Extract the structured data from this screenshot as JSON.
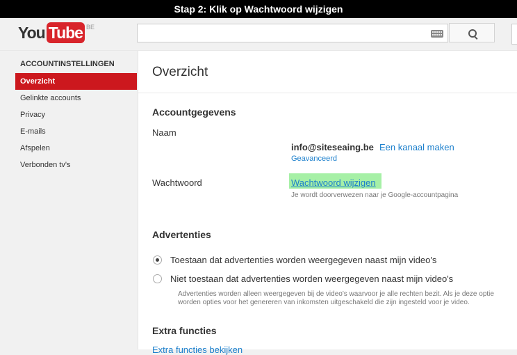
{
  "caption": "Stap 2: Klik op Wachtwoord wijzigen",
  "header": {
    "logo_you": "You",
    "logo_tube": "Tube",
    "logo_country": "BE"
  },
  "sidebar": {
    "title": "ACCOUNTINSTELLINGEN",
    "items": [
      {
        "label": "Overzicht"
      },
      {
        "label": "Gelinkte accounts"
      },
      {
        "label": "Privacy"
      },
      {
        "label": "E-mails"
      },
      {
        "label": "Afspelen"
      },
      {
        "label": "Verbonden tv's"
      }
    ]
  },
  "main": {
    "title": "Overzicht",
    "account_section": "Accountgegevens",
    "name_label": "Naam",
    "email": "info@siteseaing.be",
    "create_channel": "Een kanaal maken",
    "advanced": "Geavanceerd",
    "password_label": "Wachtwoord",
    "change_password": "Wachtwoord wijzigen",
    "password_note": "Je wordt doorverwezen naar je Google-accountpagina",
    "ads_section": "Advertenties",
    "ads_options": [
      {
        "label": "Toestaan dat advertenties worden weergegeven naast mijn video's",
        "selected": true
      },
      {
        "label": "Niet toestaan dat advertenties worden weergegeven naast mijn video's",
        "selected": false
      }
    ],
    "ads_note_line1": "Advertenties worden alleen weergegeven bij de video's waarvoor je alle rechten bezit. Als je deze optie",
    "ads_note_line2": "worden opties voor het genereren van inkomsten uitgeschakeld die zijn ingesteld voor je video.",
    "extra_section": "Extra functies",
    "extra_link": "Extra functies bekijken"
  },
  "colors": {
    "brand_red": "#cc181e",
    "link_blue": "#1b7fcc",
    "highlight_green": "#a6f0a6"
  }
}
